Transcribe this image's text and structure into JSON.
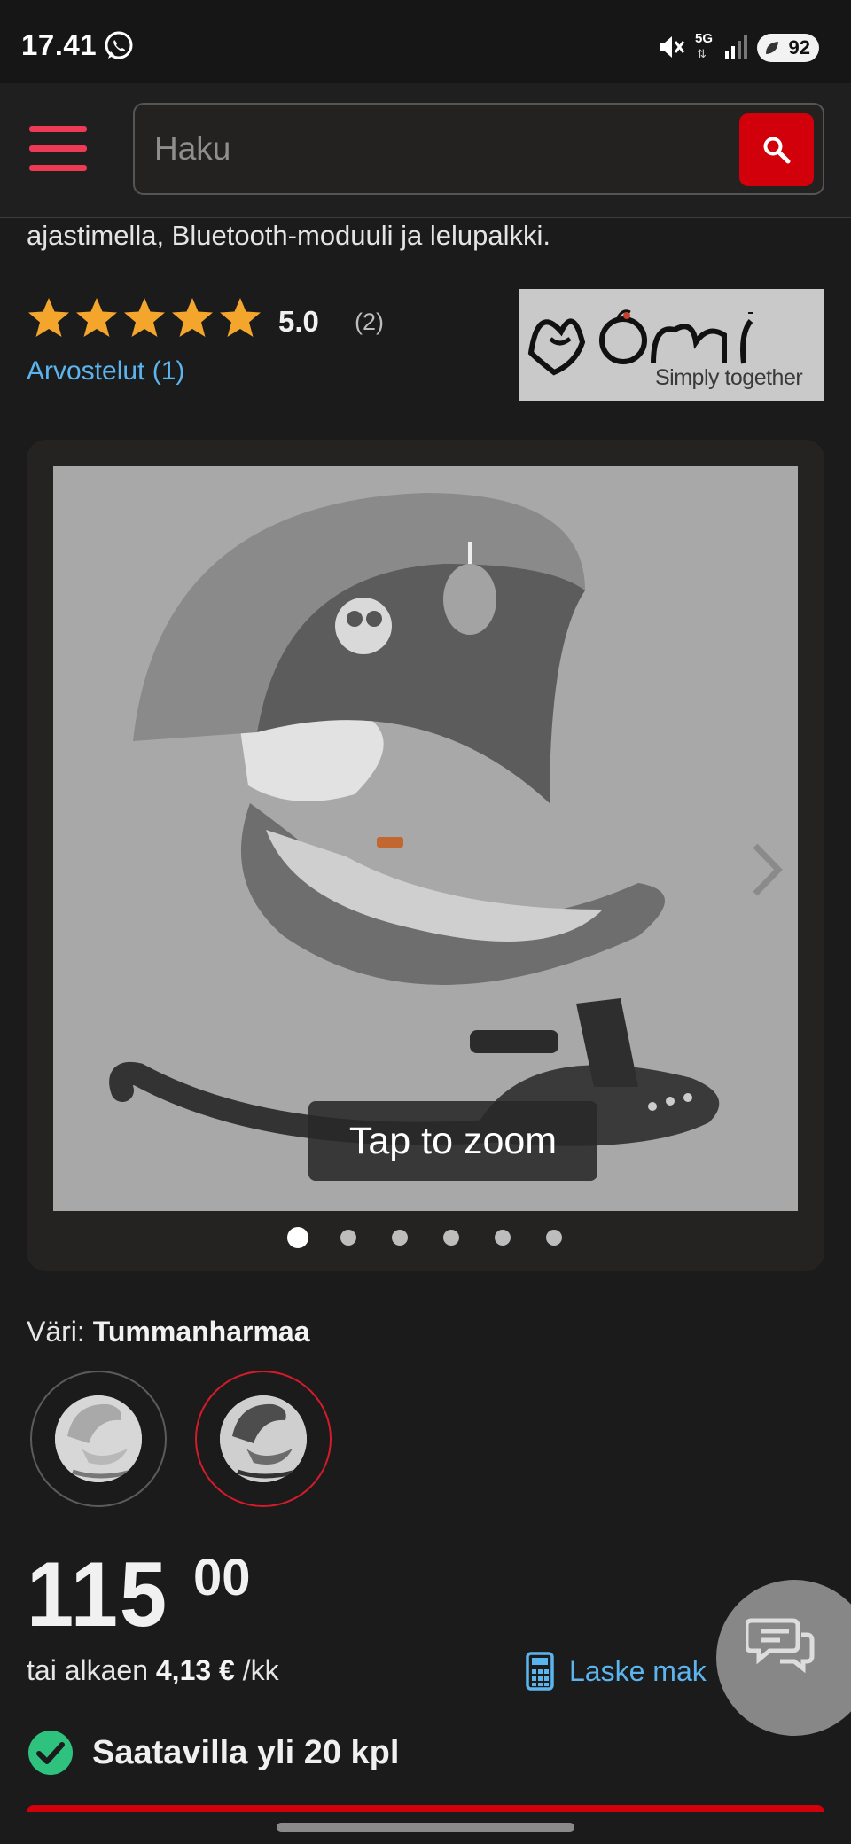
{
  "status_bar": {
    "time": "17.41",
    "network": "5G",
    "network_arrows": "⇅",
    "battery": "92",
    "icons": [
      "whatsapp-icon",
      "mute-icon",
      "signal-icon",
      "battery-icon"
    ]
  },
  "header": {
    "search_placeholder": "Haku",
    "icons": [
      "hamburger-menu-icon",
      "search-icon"
    ],
    "accent_color": "#d2000a",
    "menu_color": "#ee3a55"
  },
  "product": {
    "description_tail": "ajastimella, Bluetooth-moduuli ja lelupalkki.",
    "rating": "5.0",
    "rating_count": "(2)",
    "stars": 5,
    "reviews_link": "Arvostelut (1)",
    "brand": {
      "logo_text": "Momi",
      "tagline": "Simply together"
    },
    "gallery": {
      "zoom_label": "Tap to zoom",
      "image_count": 6,
      "active_index": 0,
      "icons": [
        "chevron-right-icon"
      ]
    },
    "color": {
      "label": "Väri:",
      "value": "Tummanharmaa",
      "options": [
        "Vaaleanharmaa",
        "Tummanharmaa"
      ],
      "selected_index": 1
    },
    "price": {
      "integer": "115",
      "decimals": "00"
    },
    "finance": {
      "prefix": "tai alkaen",
      "amount": "4,13 €",
      "suffix": "/kk",
      "calc_label": "Laske mak"
    },
    "stock": {
      "text": "Saatavilla yli 20 kpl",
      "color": "#2ec27e"
    }
  },
  "colors": {
    "link": "#5cb4ee",
    "star": "#f3a62b",
    "background": "#1b1b1c"
  }
}
